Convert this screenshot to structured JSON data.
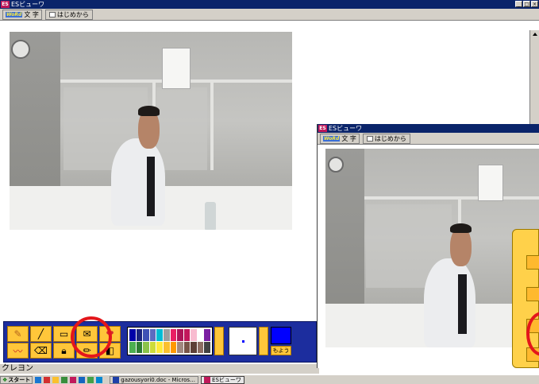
{
  "main_window": {
    "title": "ESビューワ",
    "logo": "ES",
    "buttons": {
      "word_tag": "WoRd",
      "word_label": "文 字",
      "begin_label": "はじめから"
    }
  },
  "second_window": {
    "title": "ESビューワ",
    "logo": "ES",
    "buttons": {
      "word_tag": "WoRd",
      "word_label": "文 字",
      "begin_label": "はじめから"
    }
  },
  "toolbox": {
    "pattern_label": "もよう",
    "colors_row1": [
      "#0000a8",
      "#1a237e",
      "#3f51b5",
      "#5c6bc0",
      "#00bcd4",
      "#9e9e9e",
      "#e91e63",
      "#ad1457",
      "#c2185b",
      "#f8bbd0",
      "#ffffff",
      "#7b1fa2"
    ],
    "colors_row2": [
      "#4caf50",
      "#2e7d32",
      "#8bc34a",
      "#cddc39",
      "#ffeb3b",
      "#fbc02d",
      "#ff9800",
      "#a1887f",
      "#795548",
      "#5d4037",
      "#8d6e63",
      "#424242"
    ],
    "current_color": "#0000ff"
  },
  "status": {
    "text": "クレヨン"
  },
  "taskbar": {
    "start_label": "スタート",
    "tasks": [
      {
        "label": "gazousyori0.doc - Micros…"
      },
      {
        "label": "ESビューワ"
      }
    ]
  },
  "highlight_color": "#e4161b"
}
